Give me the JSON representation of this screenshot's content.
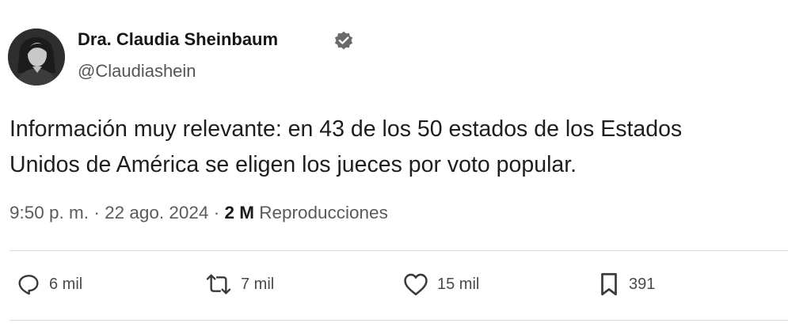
{
  "author": {
    "display_name": "Dra. Claudia Sheinbaum",
    "handle": "@Claudiashein"
  },
  "tweet": {
    "text_lines": [
      "Información muy relevante: en 43 de los 50 estados de los Estados",
      "Unidos de América se eligen los jueces por voto popular."
    ]
  },
  "meta": {
    "time": "9:50 p. m.",
    "separator": " · ",
    "date": "22 ago. 2024",
    "views_count": "2 M",
    "views_label": "Reproducciones"
  },
  "actions": {
    "replies": "6 mil",
    "reposts": "7 mil",
    "likes": "15 mil",
    "bookmarks": "391"
  },
  "icons": {
    "verified": "verified-badge-icon",
    "reply": "speech-bubble-icon",
    "repost": "repost-arrows-icon",
    "like": "heart-icon",
    "bookmark": "bookmark-icon"
  }
}
